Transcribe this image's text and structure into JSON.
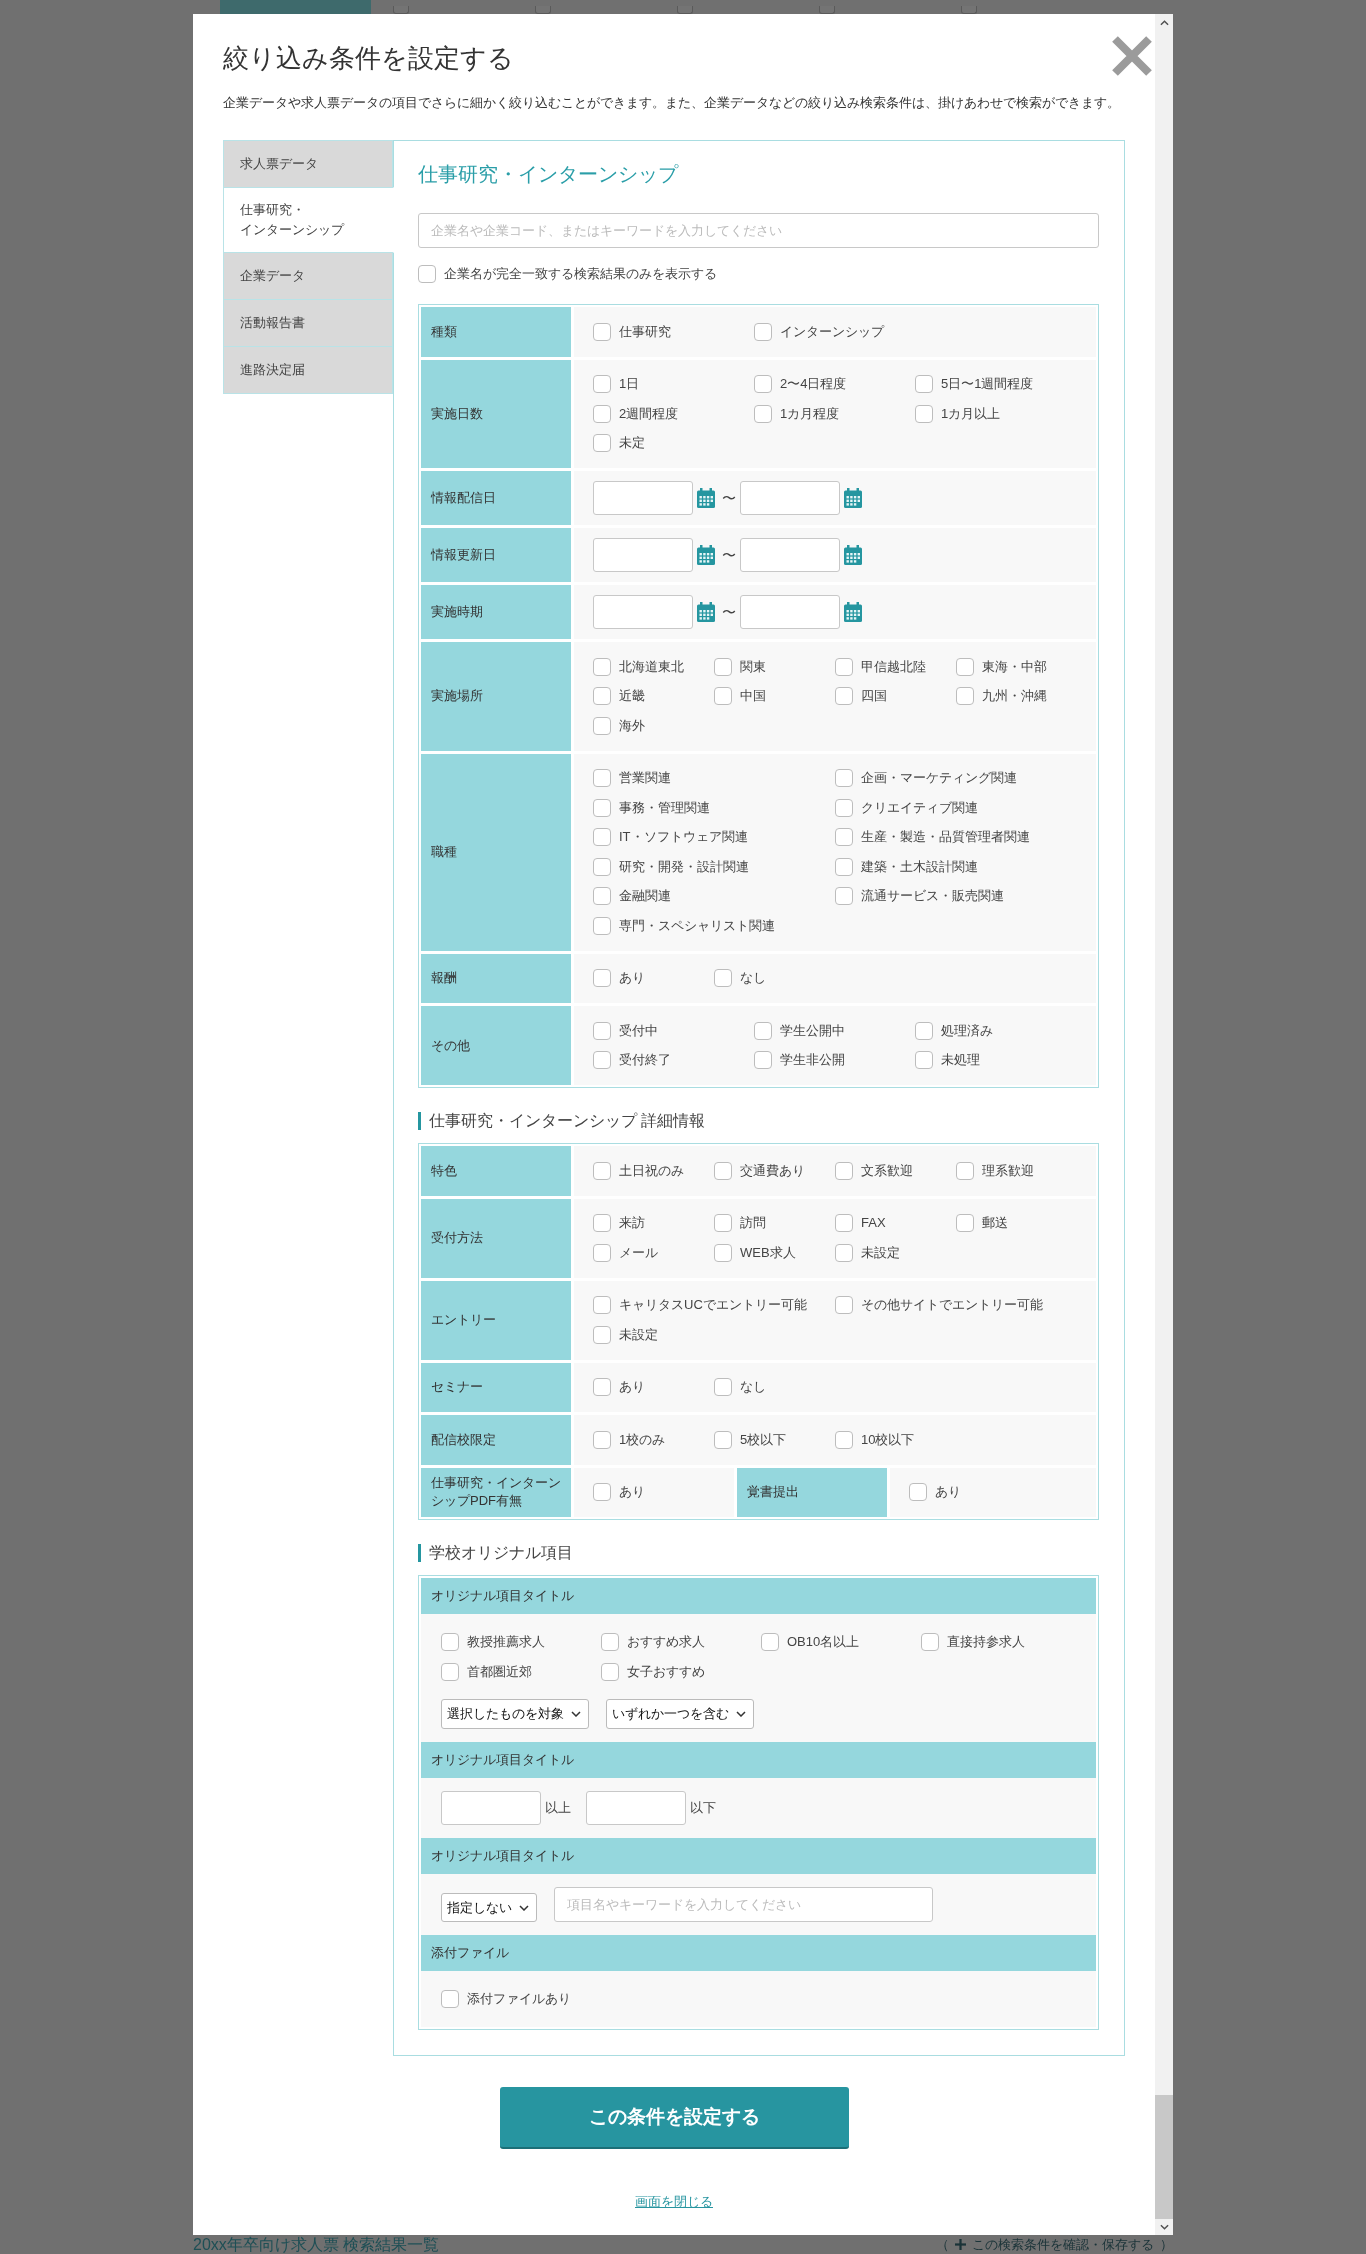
{
  "dialog": {
    "title": "絞り込み条件を設定する",
    "description": "企業データや求人票データの項目でさらに細かく絞り込むことができます。また、企業データなどの絞り込み検索条件は、掛けあわせで検索ができます。",
    "tabs": [
      {
        "label": "求人票データ",
        "selected": false
      },
      {
        "label": "仕事研究・インターンシップ",
        "selected": true
      },
      {
        "label": "企業データ",
        "selected": false
      },
      {
        "label": "活動報告書",
        "selected": false
      },
      {
        "label": "進路決定届",
        "selected": false
      }
    ]
  },
  "main": {
    "heading": "仕事研究・インターンシップ",
    "search": {
      "placeholder": "企業名や企業コード、またはキーワードを入力してください"
    },
    "exact_match": {
      "label": "企業名が完全一致する検索結果のみを表示する",
      "checked": false
    },
    "filters": [
      {
        "kind": "medium",
        "label": "種類",
        "options": [
          {
            "label": "仕事研究",
            "checked": false
          },
          {
            "label": "インターンシップ",
            "checked": false
          }
        ]
      },
      {
        "kind": "medium",
        "label": "実施日数",
        "options": [
          {
            "label": "1日",
            "checked": false
          },
          {
            "label": "2〜4日程度",
            "checked": false
          },
          {
            "label": "5日〜1週間程度",
            "checked": false
          },
          {
            "label": "2週間程度",
            "checked": false
          },
          {
            "label": "1カ月程度",
            "checked": false
          },
          {
            "label": "1カ月以上",
            "checked": false
          },
          {
            "label": "未定",
            "checked": false
          }
        ]
      },
      {
        "kind": "dates",
        "label": "情報配信日",
        "separator": "〜"
      },
      {
        "kind": "dates",
        "label": "情報更新日",
        "separator": "〜"
      },
      {
        "kind": "dates",
        "label": "実施時期",
        "separator": "〜"
      },
      {
        "kind": "compact",
        "label": "実施場所",
        "options": [
          {
            "label": "北海道東北",
            "checked": false
          },
          {
            "label": "関東",
            "checked": false
          },
          {
            "label": "甲信越北陸",
            "checked": false
          },
          {
            "label": "東海・中部",
            "checked": false
          },
          {
            "label": "近畿",
            "checked": false
          },
          {
            "label": "中国",
            "checked": false
          },
          {
            "label": "四国",
            "checked": false
          },
          {
            "label": "九州・沖縄",
            "checked": false
          },
          {
            "label": "海外",
            "checked": false
          }
        ]
      },
      {
        "kind": "wide",
        "label": "職種",
        "options": [
          {
            "label": "営業関連",
            "checked": false
          },
          {
            "label": "企画・マーケティング関連",
            "checked": false
          },
          {
            "label": "事務・管理関連",
            "checked": false
          },
          {
            "label": "クリエイティブ関連",
            "checked": false
          },
          {
            "label": "IT・ソフトウェア関連",
            "checked": false
          },
          {
            "label": "生産・製造・品質管理者関連",
            "checked": false
          },
          {
            "label": "研究・開発・設計関連",
            "checked": false
          },
          {
            "label": "建築・土木設計関連",
            "checked": false
          },
          {
            "label": "金融関連",
            "checked": false
          },
          {
            "label": "流通サービス・販売関連",
            "checked": false
          },
          {
            "label": "専門・スペシャリスト関連",
            "checked": false
          }
        ]
      },
      {
        "kind": "compact",
        "label": "報酬",
        "options": [
          {
            "label": "あり",
            "checked": false
          },
          {
            "label": "なし",
            "checked": false
          }
        ]
      },
      {
        "kind": "medium",
        "label": "その他",
        "options": [
          {
            "label": "受付中",
            "checked": false
          },
          {
            "label": "学生公開中",
            "checked": false
          },
          {
            "label": "処理済み",
            "checked": false
          },
          {
            "label": "受付終了",
            "checked": false
          },
          {
            "label": "学生非公開",
            "checked": false
          },
          {
            "label": "未処理",
            "checked": false
          }
        ]
      }
    ]
  },
  "details": {
    "heading": "仕事研究・インターンシップ 詳細情報",
    "rows": [
      {
        "kind": "compact",
        "label": "特色",
        "options": [
          {
            "label": "土日祝のみ",
            "checked": false
          },
          {
            "label": "交通費あり",
            "checked": false
          },
          {
            "label": "文系歓迎",
            "checked": false
          },
          {
            "label": "理系歓迎",
            "checked": false
          }
        ]
      },
      {
        "kind": "compact",
        "label": "受付方法",
        "options": [
          {
            "label": "来訪",
            "checked": false
          },
          {
            "label": "訪問",
            "checked": false
          },
          {
            "label": "FAX",
            "checked": false
          },
          {
            "label": "郵送",
            "checked": false
          },
          {
            "label": "メール",
            "checked": false
          },
          {
            "label": "WEB求人",
            "checked": false
          },
          {
            "label": "未設定",
            "checked": false
          }
        ]
      },
      {
        "kind": "wide",
        "label": "エントリー",
        "options": [
          {
            "label": "キャリタスUCでエントリー可能",
            "checked": false
          },
          {
            "label": "その他サイトでエントリー可能",
            "checked": false
          },
          {
            "label": "未設定",
            "checked": false
          }
        ]
      },
      {
        "kind": "compact",
        "label": "セミナー",
        "options": [
          {
            "label": "あり",
            "checked": false
          },
          {
            "label": "なし",
            "checked": false
          }
        ]
      },
      {
        "kind": "compact",
        "label": "配信校限定",
        "options": [
          {
            "label": "1校のみ",
            "checked": false
          },
          {
            "label": "5校以下",
            "checked": false
          },
          {
            "label": "10校以下",
            "checked": false
          }
        ]
      },
      {
        "kind": "split",
        "parts": [
          {
            "label": "仕事研究・インターンシップPDF有無",
            "options": [
              {
                "label": "あり",
                "checked": false
              }
            ]
          },
          {
            "label": "覚書提出",
            "options": [
              {
                "label": "あり",
                "checked": false
              }
            ]
          }
        ]
      }
    ]
  },
  "school_items": {
    "heading": "学校オリジナル項目",
    "sections": [
      {
        "kind": "choices",
        "title": "オリジナル項目タイトル",
        "options": [
          {
            "label": "教授推薦求人",
            "checked": false
          },
          {
            "label": "おすすめ求人",
            "checked": false
          },
          {
            "label": "OB10名以上",
            "checked": false
          },
          {
            "label": "直接持参求人",
            "checked": false
          },
          {
            "label": "首都圏近郊",
            "checked": false
          },
          {
            "label": "女子おすすめ",
            "checked": false
          }
        ],
        "selects": [
          "選択したものを対象",
          "いずれか一つを含む"
        ]
      },
      {
        "kind": "range",
        "title": "オリジナル項目タイトル",
        "fields": [
          {
            "suffix": "以上"
          },
          {
            "suffix": "以下"
          }
        ]
      },
      {
        "kind": "keyword",
        "title": "オリジナル項目タイトル",
        "select": "指定しない",
        "placeholder": "項目名やキーワードを入力してください"
      },
      {
        "kind": "choices",
        "title": "添付ファイル",
        "options": [
          {
            "label": "添付ファイルあり",
            "checked": false
          }
        ]
      }
    ]
  },
  "footer": {
    "submit_button": "この条件を設定する",
    "close_link": "画面を閉じる"
  },
  "background_page": {
    "checkboxes": [
      {
        "checked": false
      },
      {
        "checked": false
      },
      {
        "checked": false
      },
      {
        "checked": false
      },
      {
        "checked": false
      }
    ],
    "heading": "20xx年卒向け求人票 検索結果一覧",
    "save_link": {
      "open": "（",
      "label": "この検索条件を確認・保存する",
      "close": "）"
    }
  }
}
